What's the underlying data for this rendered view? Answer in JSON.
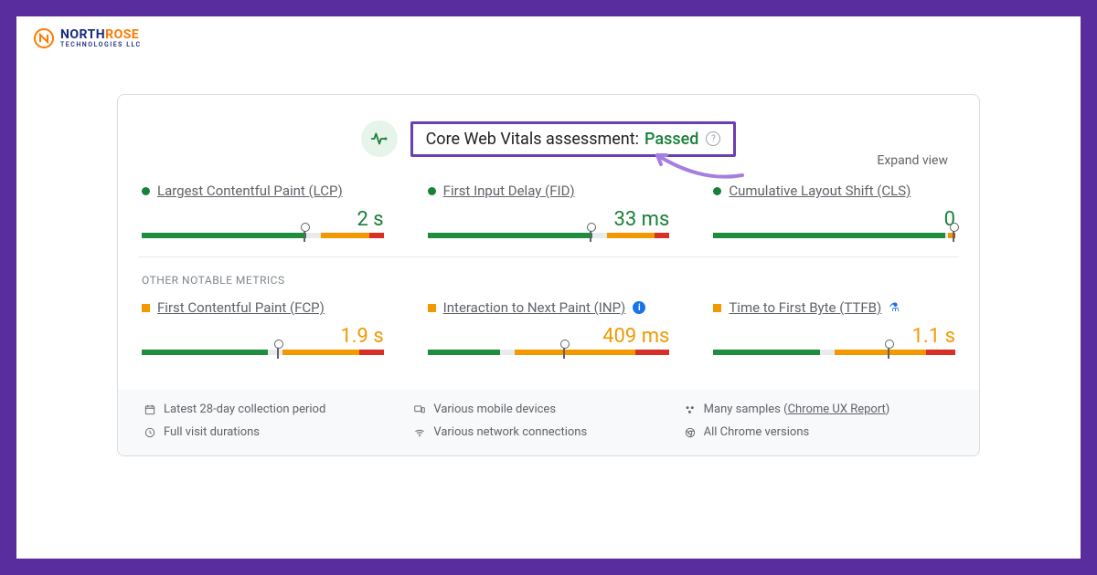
{
  "logo": {
    "north": "NORTH",
    "rose": "ROSE",
    "sub": "TECHNOLOGIES LLC"
  },
  "header": {
    "assessment_label": "Core Web Vitals assessment:",
    "assessment_result": "Passed",
    "help": "?",
    "expand": "Expand view"
  },
  "metrics_primary": [
    {
      "name": "Largest Contentful Paint (LCP)",
      "value": "2 s",
      "status": "green",
      "marker_pct": 67,
      "seg": [
        68,
        6,
        20,
        6
      ]
    },
    {
      "name": "First Input Delay (FID)",
      "value": "33 ms",
      "status": "green",
      "marker_pct": 67,
      "seg": [
        68,
        6,
        20,
        6
      ]
    },
    {
      "name": "Cumulative Layout Shift (CLS)",
      "value": "0",
      "status": "green",
      "marker_pct": 99,
      "seg": [
        96,
        1,
        2,
        1
      ]
    }
  ],
  "section_other": "OTHER NOTABLE METRICS",
  "metrics_other": [
    {
      "name": "First Contentful Paint (FCP)",
      "value": "1.9 s",
      "status": "amber",
      "marker_pct": 56,
      "seg": [
        52,
        6,
        32,
        10
      ],
      "badge": null
    },
    {
      "name": "Interaction to Next Paint (INP)",
      "value": "409 ms",
      "status": "amber",
      "marker_pct": 56,
      "seg": [
        30,
        6,
        50,
        14
      ],
      "badge": "info"
    },
    {
      "name": "Time to First Byte (TTFB)",
      "value": "1.1 s",
      "status": "amber",
      "marker_pct": 72,
      "seg": [
        44,
        6,
        38,
        12
      ],
      "badge": "flask"
    }
  ],
  "footer": {
    "period": "Latest 28-day collection period",
    "devices": "Various mobile devices",
    "samples_prefix": "Many samples (",
    "samples_link": "Chrome UX Report",
    "samples_suffix": ")",
    "durations": "Full visit durations",
    "network": "Various network connections",
    "versions": "All Chrome versions"
  }
}
